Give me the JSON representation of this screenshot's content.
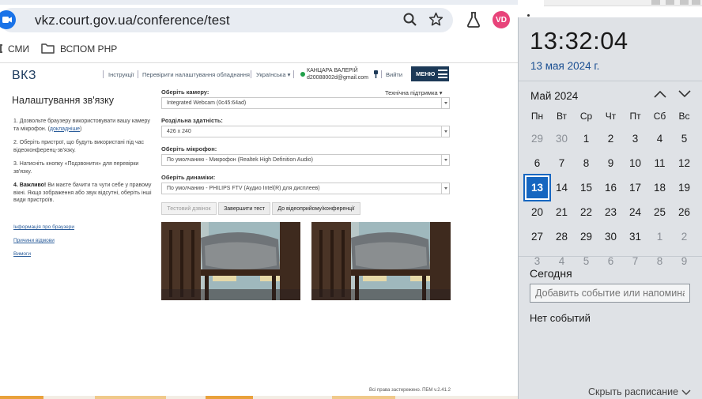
{
  "browser": {
    "url": "vkz.court.gov.ua/conference/test",
    "avatar_initials": "VD",
    "bookmarks": [
      {
        "label": "СМИ"
      },
      {
        "label": "ВСПОМ РНР"
      }
    ]
  },
  "header": {
    "logo": "ВКЗ",
    "nav": [
      {
        "label": "Інструкції"
      },
      {
        "label": "Перевірити налаштування обладнання"
      },
      {
        "label": "Українська ▾"
      }
    ],
    "user_name": "КАНЦАРА ВАЛЕРІЙ",
    "user_email": "d20088002d@gmail.com",
    "logout": "Вийти",
    "menu": "МЕНЮ"
  },
  "left": {
    "title": "Налаштування зв'язку",
    "steps": [
      {
        "text": "1. Дозвольте браузеру використовувати вашу камеру та мікрофон. (",
        "link": "докладніше",
        "tail": ")"
      },
      {
        "text": "2. Оберіть пристрої, що будуть використані під час відеоконференц-зв'язку."
      },
      {
        "text": "3. Натисніть кнопку «Подзвонити» для перевірки зв'язку."
      },
      {
        "bold": "4. Важливо!",
        "text": " Ви маєте бачити та чути себе у правому вікні. Якщо зображення або звук відсутні, оберіть інші види пристроїв."
      }
    ],
    "links": [
      {
        "label": "Інформація про браузери"
      },
      {
        "label": "Причини відмови"
      },
      {
        "label": "Вимоги"
      }
    ]
  },
  "form": {
    "support": "Технічна підтримка ▾",
    "camera_label": "Оберіть камеру:",
    "camera_value": "Integrated Webcam (0c45:64ad)",
    "resolution_label": "Роздільна здатність:",
    "resolution_value": "426 x 240",
    "mic_label": "Оберіть мікрофон:",
    "mic_value": "По умолчанию - Микрофон (Realtek High Definition Audio)",
    "speakers_label": "Оберіть динаміки:",
    "speakers_value": "По умолчанию - PHILIPS FTV (Аудио Intel(R) для дисплеев)",
    "buttons": [
      {
        "label": "Тестовий дзвінок"
      },
      {
        "label": "Завершити тест"
      },
      {
        "label": "До відеоприйому/конференції"
      }
    ]
  },
  "footer": "Всі права застережено. ПБМ v.2.41.2",
  "calendar": {
    "time": "13:32:04",
    "date": "13 мая 2024 г.",
    "month": "Май 2024",
    "weekdays": [
      "Пн",
      "Вт",
      "Ср",
      "Чт",
      "Пт",
      "Сб",
      "Вс"
    ],
    "days": [
      {
        "d": "29",
        "m": true
      },
      {
        "d": "30",
        "m": true
      },
      {
        "d": "1"
      },
      {
        "d": "2"
      },
      {
        "d": "3"
      },
      {
        "d": "4"
      },
      {
        "d": "5"
      },
      {
        "d": "6"
      },
      {
        "d": "7"
      },
      {
        "d": "8"
      },
      {
        "d": "9"
      },
      {
        "d": "10"
      },
      {
        "d": "11"
      },
      {
        "d": "12"
      },
      {
        "d": "13",
        "t": true
      },
      {
        "d": "14"
      },
      {
        "d": "15"
      },
      {
        "d": "16"
      },
      {
        "d": "17"
      },
      {
        "d": "18"
      },
      {
        "d": "19"
      },
      {
        "d": "20"
      },
      {
        "d": "21"
      },
      {
        "d": "22"
      },
      {
        "d": "23"
      },
      {
        "d": "24"
      },
      {
        "d": "25"
      },
      {
        "d": "26"
      },
      {
        "d": "27"
      },
      {
        "d": "28"
      },
      {
        "d": "29"
      },
      {
        "d": "30"
      },
      {
        "d": "31"
      },
      {
        "d": "1",
        "m": true
      },
      {
        "d": "2",
        "m": true
      },
      {
        "d": "3",
        "m": true
      },
      {
        "d": "4",
        "m": true
      },
      {
        "d": "5",
        "m": true
      },
      {
        "d": "6",
        "m": true
      },
      {
        "d": "7",
        "m": true
      },
      {
        "d": "8",
        "m": true
      },
      {
        "d": "9",
        "m": true
      }
    ],
    "today_label": "Сегодня",
    "event_placeholder": "Добавить событие или напоминание",
    "no_events": "Нет событий",
    "hide_schedule": "Скрыть расписание"
  },
  "colors": {
    "accent": "#1666c0",
    "menu_bg": "#1c3957",
    "avatar": "#e8437a",
    "online": "#21a04a"
  }
}
